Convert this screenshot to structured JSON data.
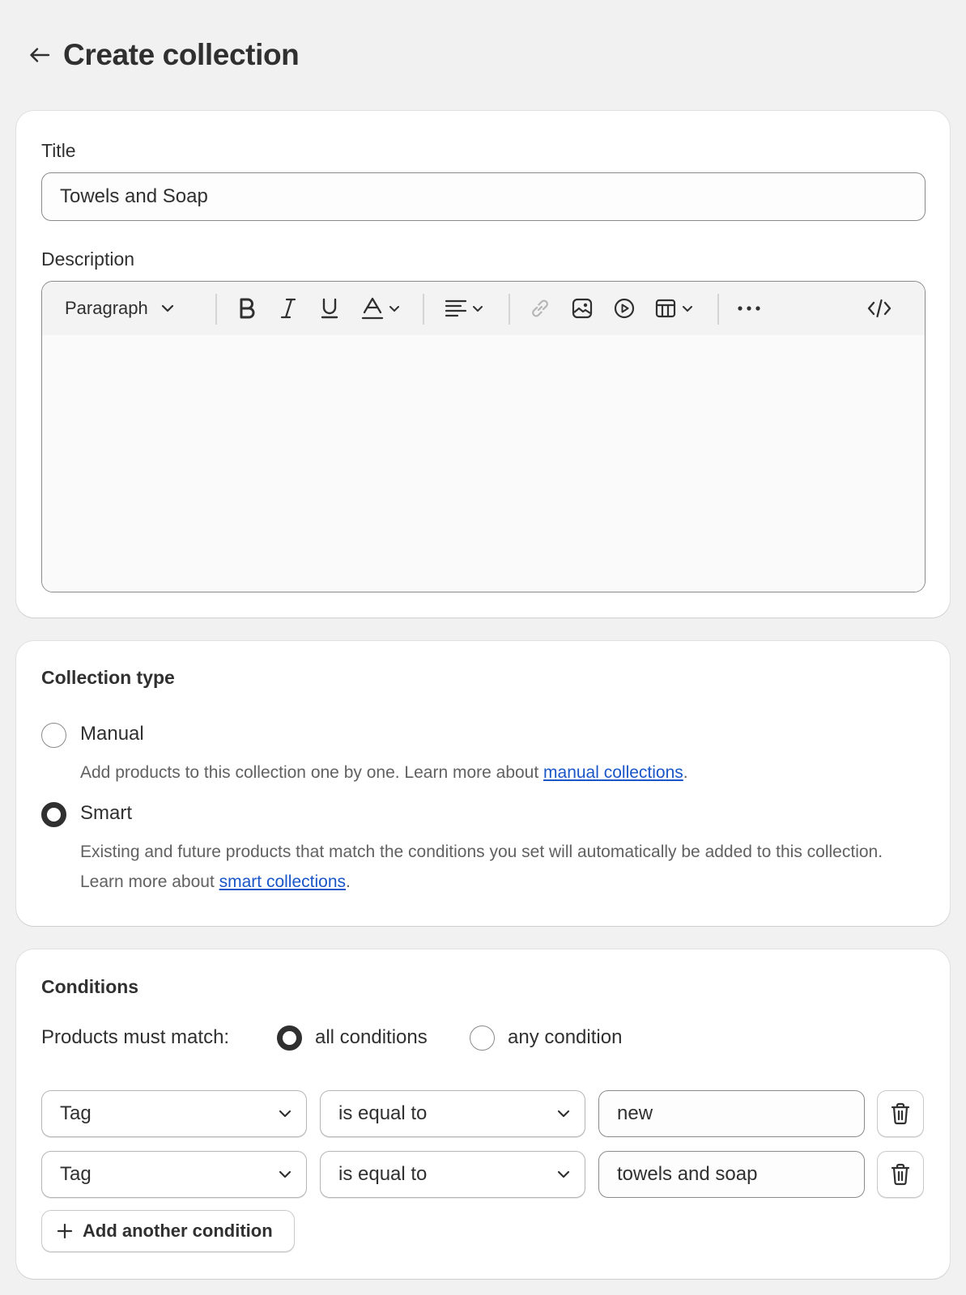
{
  "header": {
    "title": "Create collection"
  },
  "details": {
    "title_label": "Title",
    "title_value": "Towels and Soap",
    "description_label": "Description",
    "toolbar": {
      "paragraph_label": "Paragraph"
    },
    "description_value": ""
  },
  "collection_type": {
    "heading": "Collection type",
    "selected": "Smart",
    "manual": {
      "label": "Manual",
      "help_prefix": "Add products to this collection one by one. Learn more about ",
      "help_link": "manual collections",
      "help_suffix": "."
    },
    "smart": {
      "label": "Smart",
      "help_prefix": "Existing and future products that match the conditions you set will automatically be added to this collection. Learn more about ",
      "help_link": "smart collections",
      "help_suffix": "."
    }
  },
  "conditions": {
    "heading": "Conditions",
    "match_label": "Products must match:",
    "match_all_label": "all conditions",
    "match_any_label": "any condition",
    "match_selected": "all conditions",
    "rows": [
      {
        "field": "Tag",
        "operator": "is equal to",
        "value": "new"
      },
      {
        "field": "Tag",
        "operator": "is equal to",
        "value": "towels and soap"
      }
    ],
    "add_label": "Add another condition"
  },
  "colors": {
    "background": "#f1f1f1",
    "card": "#ffffff",
    "text": "#303030",
    "muted_text": "#616161",
    "link": "#1a56c8"
  }
}
